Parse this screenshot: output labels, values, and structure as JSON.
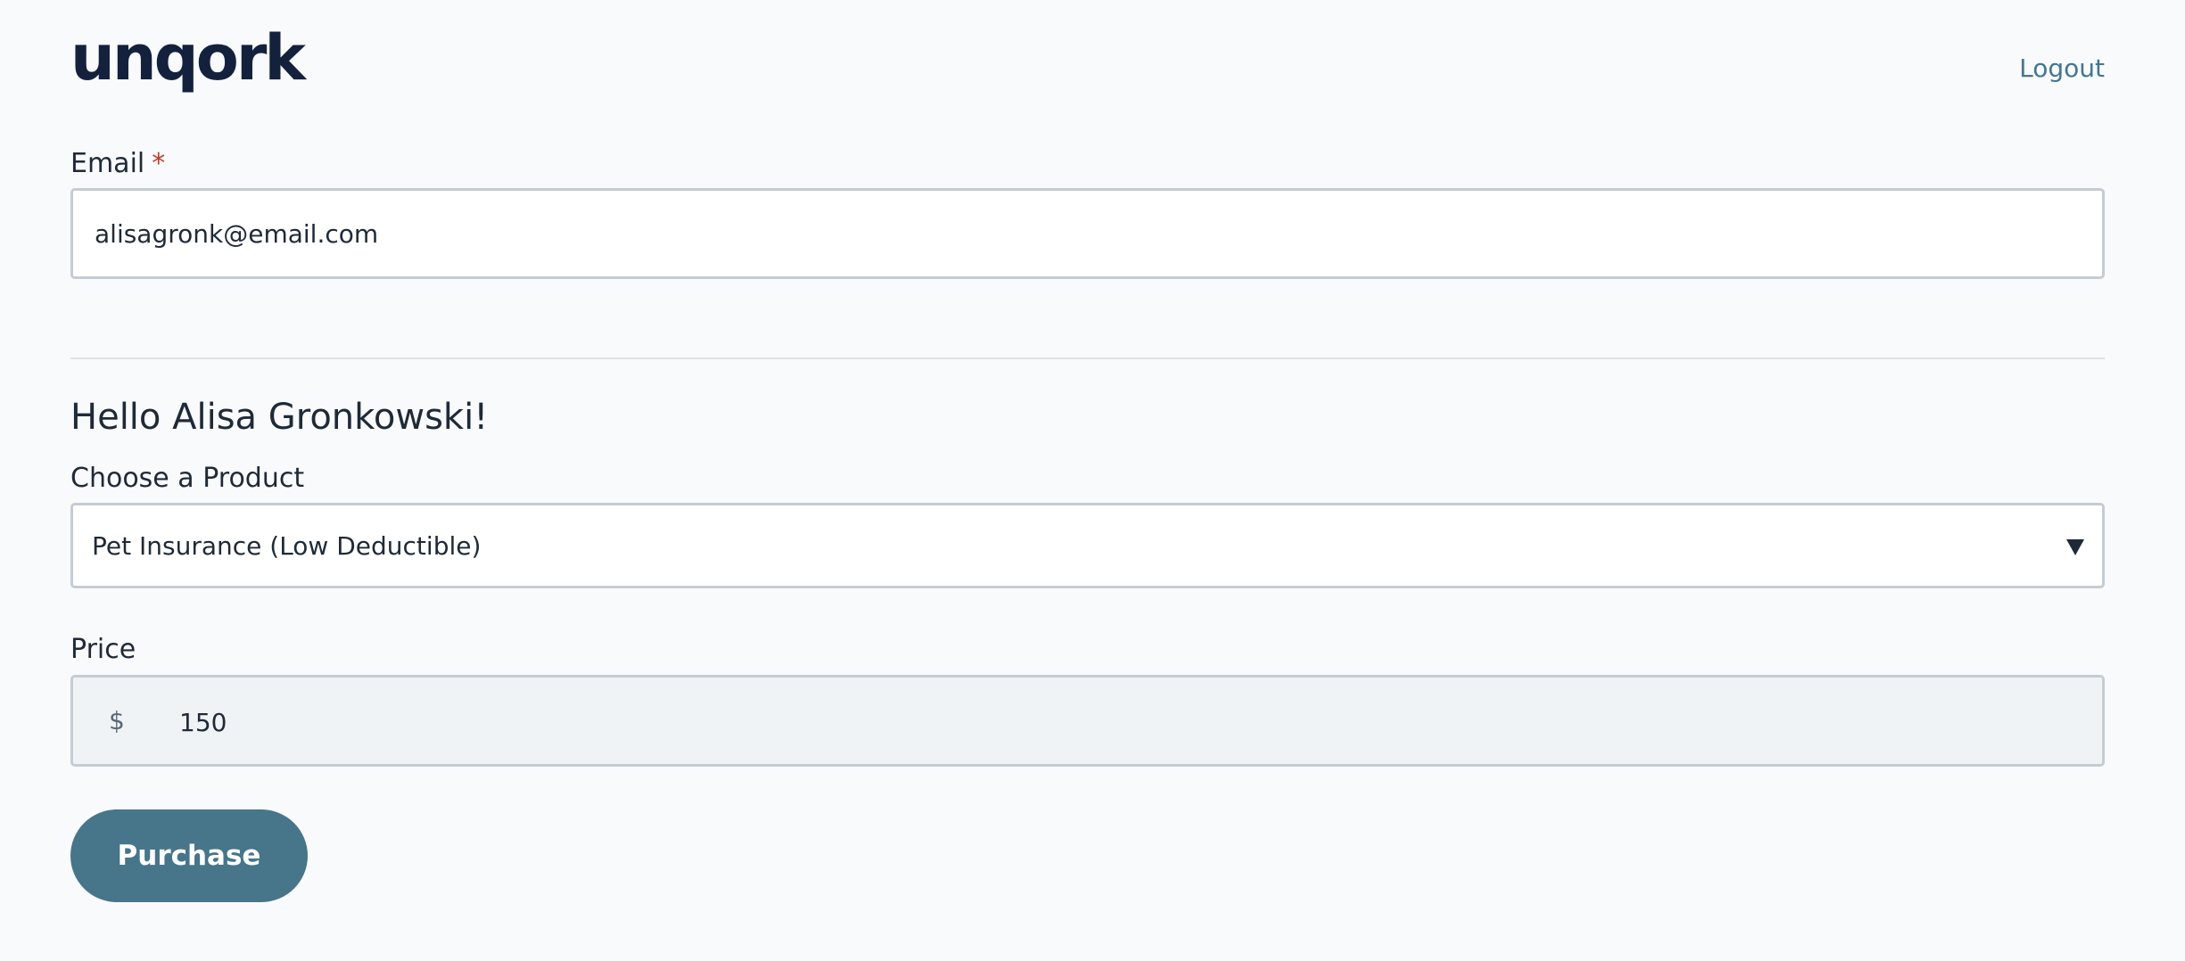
{
  "header": {
    "logo_text": "unqork",
    "logout_label": "Logout"
  },
  "email": {
    "label": "Email",
    "required_marker": "*",
    "value": "alisagronk@email.com"
  },
  "greeting": "Hello Alisa Gronkowski!",
  "product": {
    "label": "Choose a Product",
    "selected_value": "Pet Insurance (Low Deductible)",
    "icon": "caret-down-icon"
  },
  "price": {
    "label": "Price",
    "currency_symbol": "$",
    "value": "150"
  },
  "purchase_button_label": "Purchase",
  "colors": {
    "background": "#f8fafc",
    "logo": "#14213d",
    "accent": "#467590",
    "button": "#477589",
    "required": "#c0392b",
    "input_border": "#c4ccd4",
    "readonly_background": "#eff3f6"
  }
}
